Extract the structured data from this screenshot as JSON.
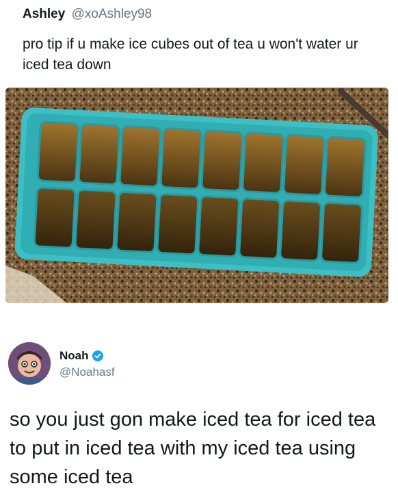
{
  "tweet1": {
    "display_name": "Ashley",
    "handle": "@xoAshley98",
    "text": "pro tip if u make ice cubes out of tea u won't water ur iced tea down",
    "image": {
      "subject": "turquoise ice cube tray filled with frozen tea cubes on granite countertop",
      "rows": 2,
      "cells_per_row": 8
    }
  },
  "tweet2": {
    "display_name": "Noah",
    "handle": "@Noahasf",
    "verified": true,
    "text": "so you just gon make iced tea for iced tea to put in iced tea with my iced tea using some iced tea"
  },
  "colors": {
    "name_text": "#14171a",
    "handle_text": "#657786",
    "verified_badge": "#1da1f2",
    "tray": "#3cc0c6",
    "tea": "#6b4a1a"
  },
  "icons": {
    "verified": "verified-badge-icon"
  }
}
